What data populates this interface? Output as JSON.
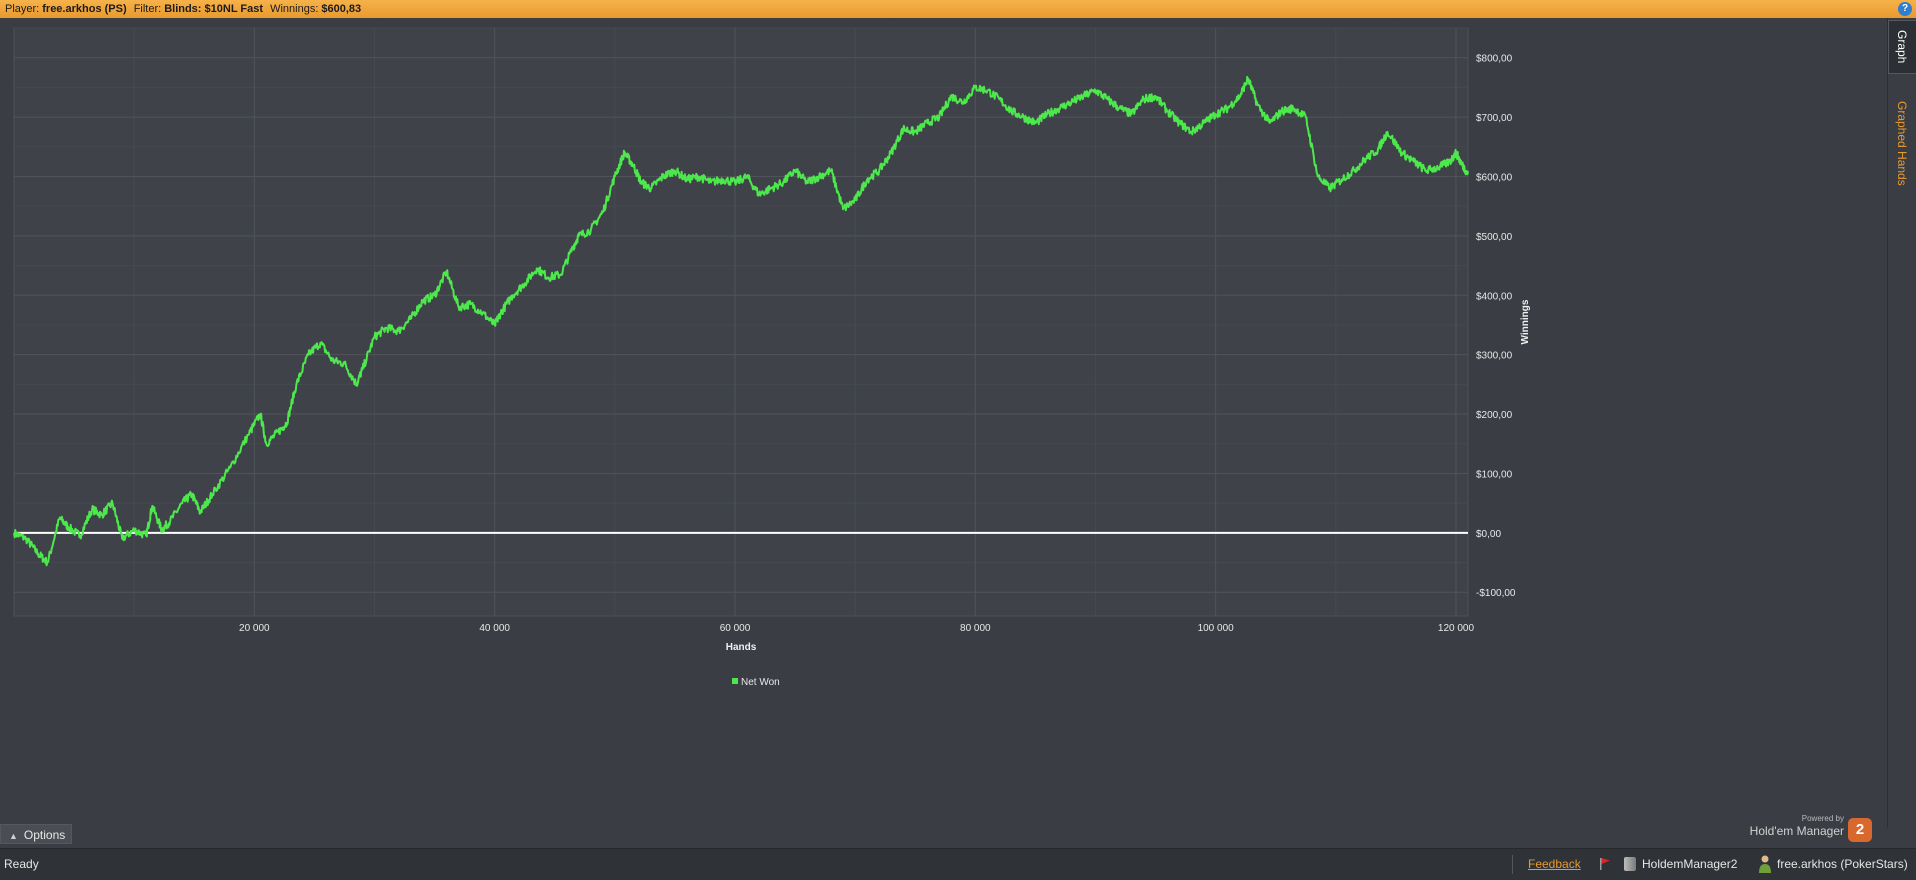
{
  "topbar": {
    "player_label": "Player:",
    "player_value": "free.arkhos (PS)",
    "filter_label": "Filter:",
    "filter_value": "Blinds: $10NL Fast",
    "winnings_label": "Winnings:",
    "winnings_value": "$600,83",
    "help_icon": "?"
  },
  "side_tabs": {
    "graph": "Graph",
    "graphed_hands": "Graphed Hands"
  },
  "options": {
    "label": "Options"
  },
  "powered_by": {
    "small": "Powered by",
    "name": "Hold'em Manager",
    "badge": "2"
  },
  "status": {
    "ready": "Ready",
    "feedback": "Feedback",
    "database": "HoldemManager2",
    "user": "free.arkhos (PokerStars)"
  },
  "colors": {
    "topbar": "#e89a2e",
    "series": "#4ce84c",
    "zero_line": "#ffffff",
    "background": "#3a3e44",
    "plot_background": "#3f4349"
  },
  "chart_data": {
    "type": "line",
    "title": "",
    "xlabel": "Hands",
    "ylabel": "Winnings",
    "xlim": [
      0,
      121000
    ],
    "ylim": [
      -140,
      850
    ],
    "x_ticks": [
      20000,
      40000,
      60000,
      80000,
      100000,
      120000
    ],
    "x_tick_labels": [
      "20 000",
      "40 000",
      "60 000",
      "80 000",
      "100 000",
      "120 000"
    ],
    "y_ticks": [
      -100,
      0,
      100,
      200,
      300,
      400,
      500,
      600,
      700,
      800
    ],
    "y_tick_labels": [
      "-$100,00",
      "$0,00",
      "$100,00",
      "$200,00",
      "$300,00",
      "$400,00",
      "$500,00",
      "$600,00",
      "$700,00",
      "$800,00"
    ],
    "grid": true,
    "legend_position": "bottom-center",
    "series": [
      {
        "name": "Net Won",
        "x": [
          0,
          1000,
          2000,
          2800,
          3800,
          4500,
          5500,
          6500,
          7300,
          8200,
          9000,
          10000,
          11000,
          11500,
          12300,
          13000,
          14000,
          14800,
          15500,
          16500,
          18000,
          19500,
          20500,
          21000,
          22000,
          22700,
          23500,
          24500,
          25500,
          26500,
          27500,
          28500,
          29000,
          30000,
          31000,
          32000,
          33000,
          34000,
          35000,
          36000,
          37000,
          38000,
          39000,
          40000,
          40500,
          41500,
          42500,
          43500,
          44500,
          45500,
          46500,
          47000,
          48000,
          49000,
          50000,
          50800,
          51500,
          52200,
          53000,
          54000,
          55000,
          56000,
          57000,
          58000,
          59000,
          60000,
          61000,
          62000,
          63000,
          64000,
          65000,
          66000,
          67000,
          68000,
          69000,
          70000,
          71000,
          72000,
          73000,
          74000,
          75000,
          76000,
          77000,
          78000,
          79000,
          80000,
          81000,
          82000,
          83000,
          84000,
          85000,
          86000,
          87000,
          88000,
          89000,
          90000,
          91000,
          92000,
          93000,
          94000,
          95000,
          96000,
          97000,
          98000,
          99000,
          100000,
          101000,
          102000,
          102700,
          103500,
          104500,
          105500,
          106500,
          107500,
          108500,
          109500,
          110500,
          111500,
          112500,
          113500,
          114300,
          115500,
          116500,
          117500,
          118500,
          119500,
          120000,
          120500,
          121000
        ],
        "y": [
          0,
          -10,
          -35,
          -50,
          25,
          10,
          -5,
          40,
          30,
          50,
          -10,
          5,
          -5,
          45,
          5,
          20,
          50,
          65,
          35,
          65,
          110,
          165,
          200,
          150,
          170,
          185,
          250,
          300,
          320,
          290,
          285,
          250,
          275,
          330,
          345,
          340,
          360,
          390,
          400,
          440,
          380,
          385,
          370,
          350,
          370,
          400,
          420,
          445,
          430,
          435,
          480,
          500,
          510,
          540,
          600,
          640,
          620,
          590,
          580,
          600,
          610,
          595,
          600,
          590,
          595,
          590,
          600,
          570,
          580,
          590,
          610,
          590,
          600,
          610,
          545,
          560,
          595,
          610,
          640,
          680,
          675,
          690,
          700,
          735,
          725,
          750,
          745,
          730,
          710,
          700,
          690,
          705,
          715,
          725,
          735,
          745,
          730,
          715,
          705,
          730,
          735,
          710,
          690,
          675,
          690,
          705,
          715,
          735,
          765,
          720,
          690,
          710,
          715,
          700,
          600,
          580,
          595,
          610,
          630,
          645,
          675,
          640,
          625,
          610,
          615,
          625,
          640,
          620,
          605
        ]
      }
    ]
  }
}
